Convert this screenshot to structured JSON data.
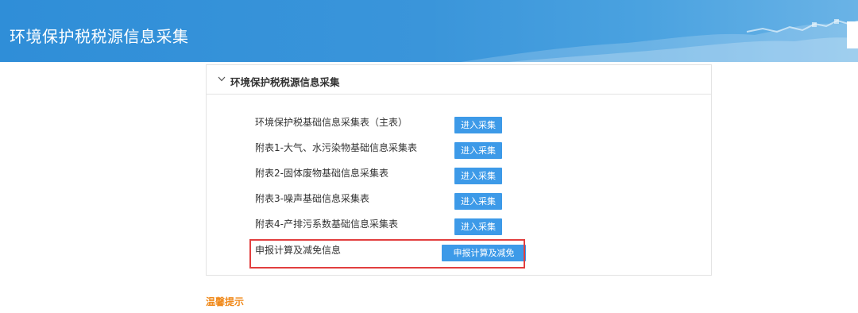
{
  "header": {
    "title": "环境保护税税源信息采集"
  },
  "panel": {
    "title": "环境保护税税源信息采集",
    "rows": [
      {
        "label": "环境保护税基础信息采集表（主表）",
        "button": "进入采集"
      },
      {
        "label": "附表1-大气、水污染物基础信息采集表",
        "button": "进入采集"
      },
      {
        "label": "附表2-固体废物基础信息采集表",
        "button": "进入采集"
      },
      {
        "label": "附表3-噪声基础信息采集表",
        "button": "进入采集"
      },
      {
        "label": "附表4-产排污系数基础信息采集表",
        "button": "进入采集"
      },
      {
        "label": "申报计算及减免信息",
        "button": "申报计算及减免"
      }
    ]
  },
  "tips": {
    "title": "温馨提示"
  },
  "colors": {
    "header_blue": "#2f8ed8",
    "button_blue": "#3d9ae8",
    "highlight_red": "#e23f3f",
    "tips_orange": "#f08a1c"
  }
}
